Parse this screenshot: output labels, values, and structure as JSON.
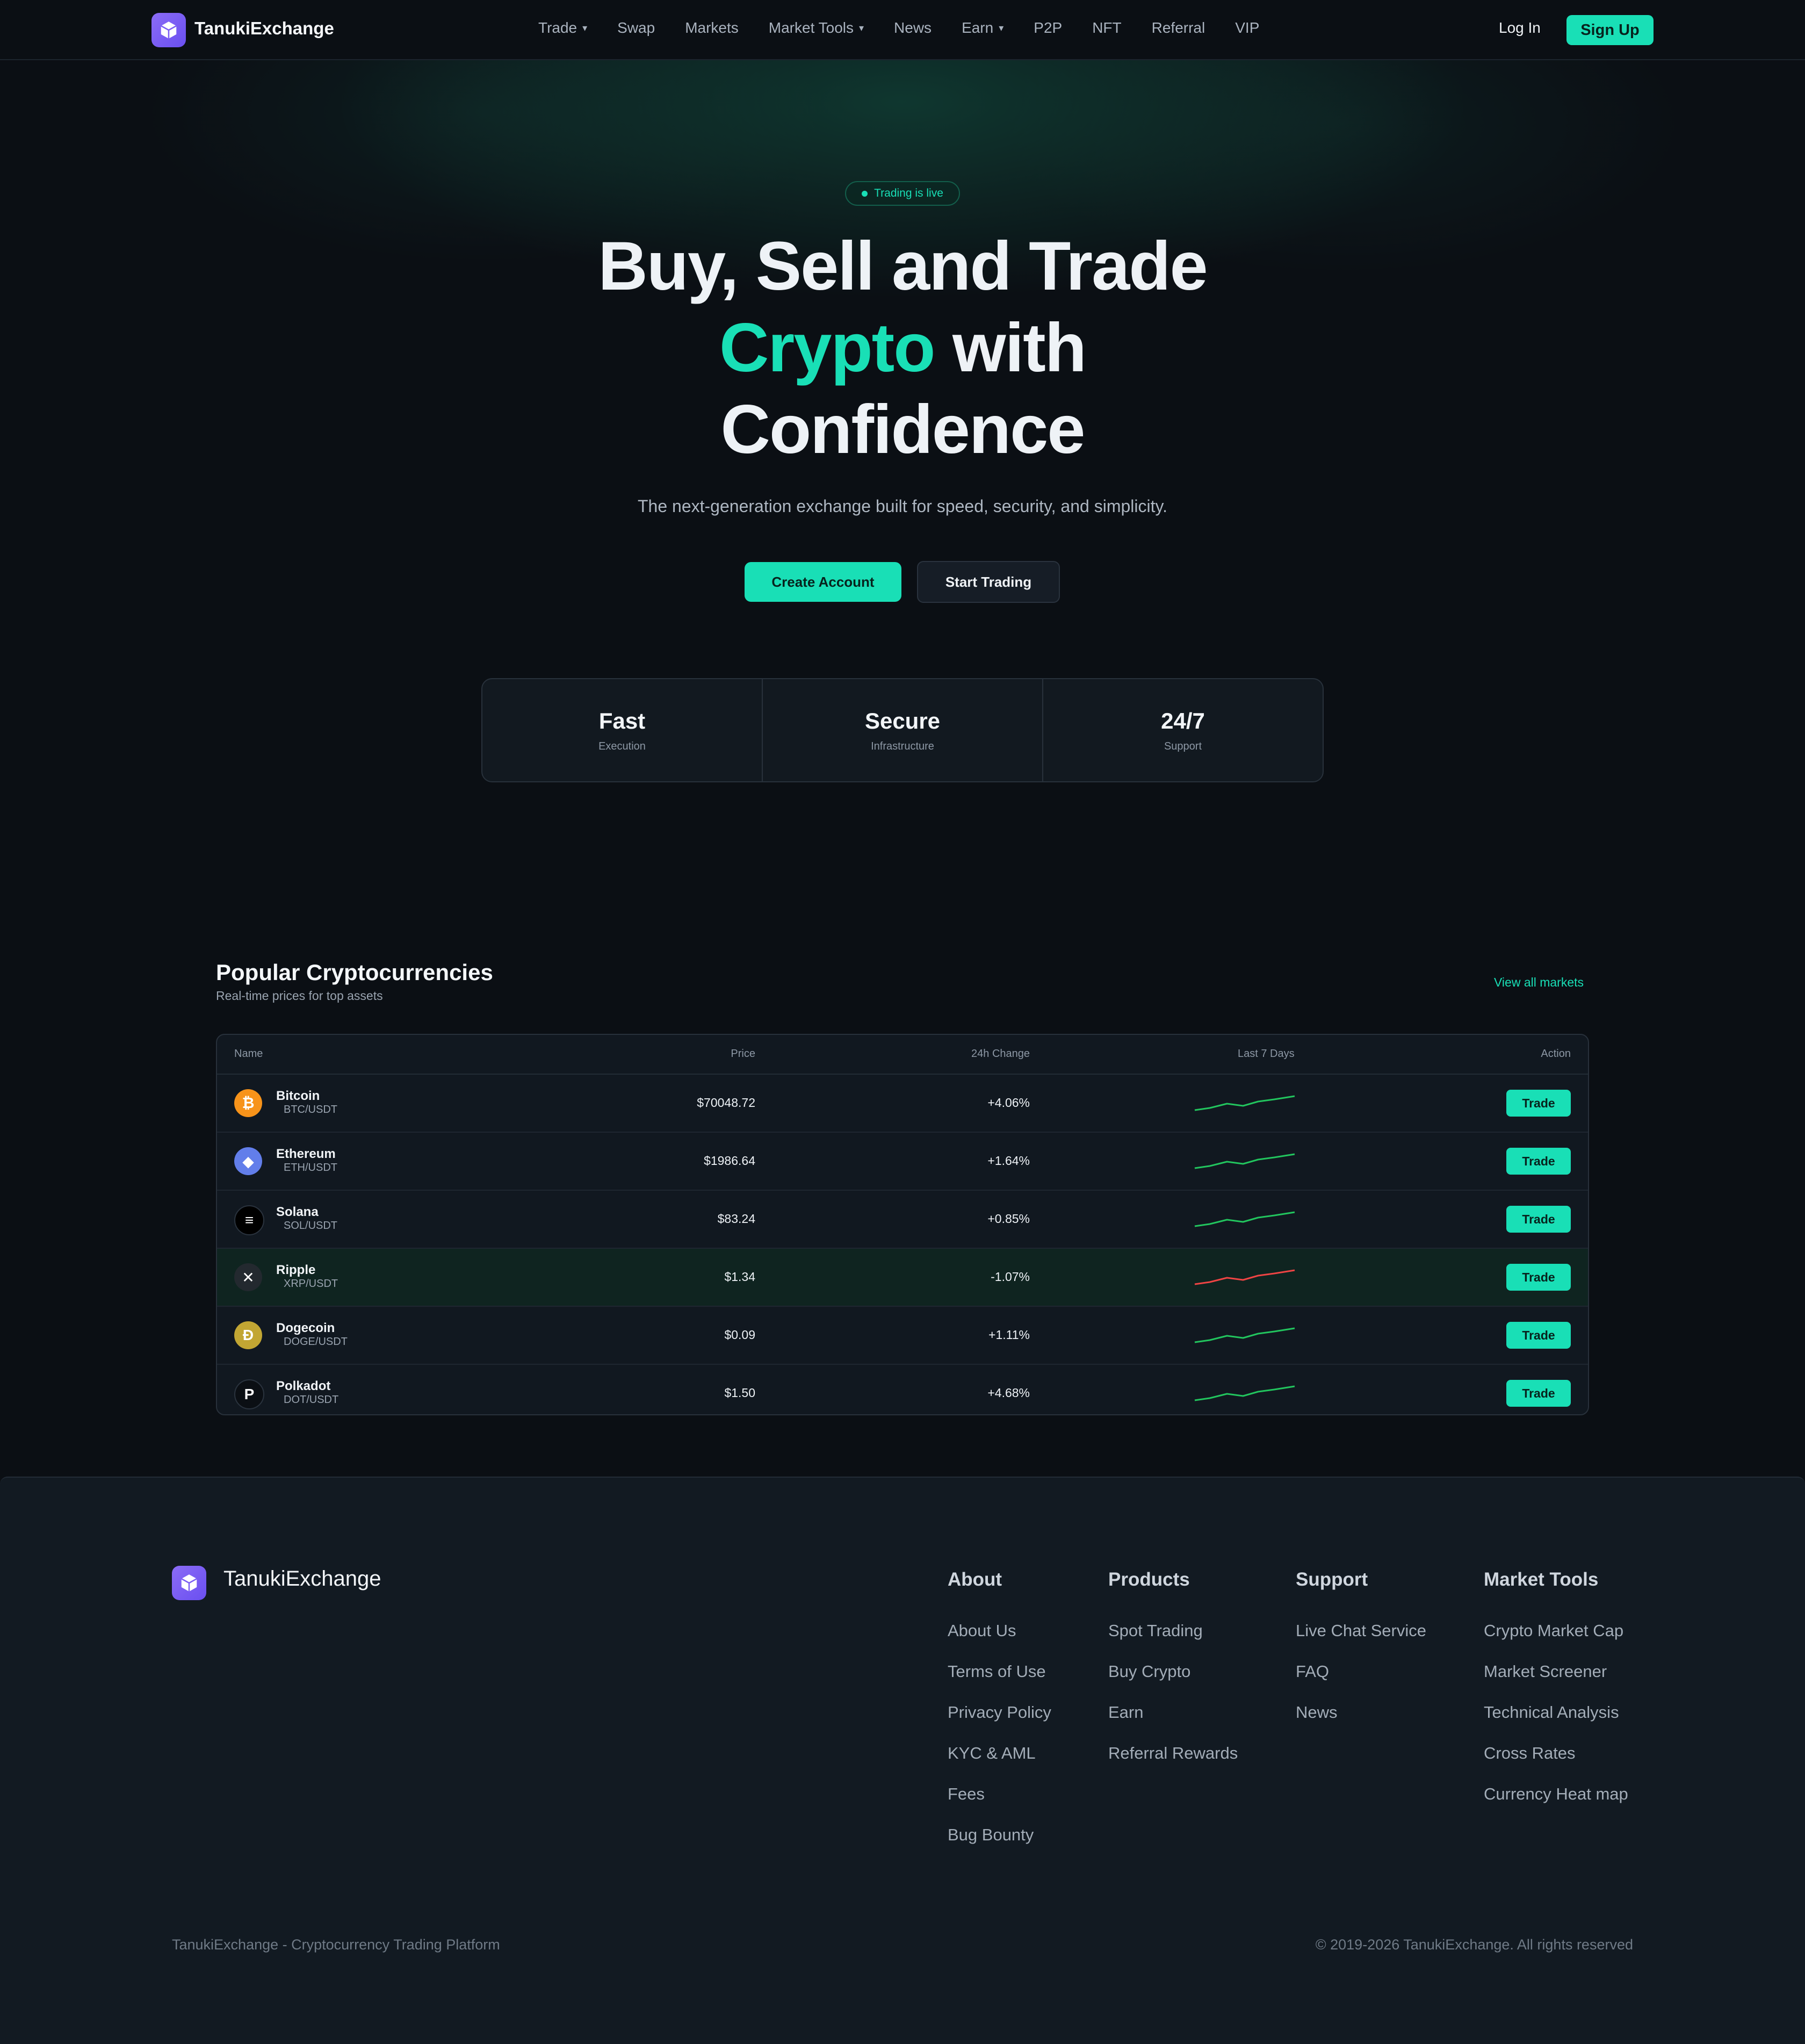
{
  "navbar": {
    "brand": "TanukiExchange",
    "links": [
      {
        "label": "Trade",
        "caret": "▾"
      },
      {
        "label": "Swap",
        "caret": ""
      },
      {
        "label": "Markets",
        "caret": ""
      },
      {
        "label": "Market Tools",
        "caret": "▾"
      },
      {
        "label": "News",
        "caret": ""
      },
      {
        "label": "Earn",
        "caret": "▾"
      },
      {
        "label": "P2P",
        "caret": ""
      },
      {
        "label": "NFT",
        "caret": ""
      },
      {
        "label": "Referral",
        "caret": ""
      },
      {
        "label": "VIP",
        "caret": ""
      }
    ],
    "login": "Log In",
    "signup": "Sign Up"
  },
  "hero": {
    "badge": "Trading is live",
    "title_line1": "Buy, Sell and Trade",
    "title_accent": "Crypto",
    "title_line2_rest": " with",
    "title_line3": "Confidence",
    "subtitle": "The next-generation exchange built for speed, security, and simplicity.",
    "cta_primary": "Create Account",
    "cta_secondary": "Start Trading",
    "stats": [
      {
        "value": "Fast",
        "label": "Execution"
      },
      {
        "value": "Secure",
        "label": "Infrastructure"
      },
      {
        "value": "24/7",
        "label": "Support"
      }
    ]
  },
  "markets": {
    "title": "Popular Cryptocurrencies",
    "subtitle": "Real-time prices for top assets",
    "view_all": "View all markets",
    "columns": {
      "name": "Name",
      "price": "Price",
      "change": "24h Change",
      "chart": "Last 7 Days",
      "action": "Action"
    },
    "rows": [
      {
        "name": "Bitcoin",
        "pair": "BTC/USDT",
        "price": "$70048.72",
        "change": "+4.06%",
        "trend": "up",
        "icon": "bitcoin-icon",
        "icon_color": "#f7931a",
        "icon_glyph": "₿",
        "trade": "Trade"
      },
      {
        "name": "Ethereum",
        "pair": "ETH/USDT",
        "price": "$1986.64",
        "change": "+1.64%",
        "trend": "up",
        "icon": "ethereum-icon",
        "icon_color": "#627eea",
        "icon_glyph": "◆",
        "trade": "Trade"
      },
      {
        "name": "Solana",
        "pair": "SOL/USDT",
        "price": "$83.24",
        "change": "+0.85%",
        "trend": "up",
        "icon": "solana-icon",
        "icon_color": "#000000",
        "icon_glyph": "≡",
        "trade": "Trade"
      },
      {
        "name": "Ripple",
        "pair": "XRP/USDT",
        "price": "$1.34",
        "change": "-1.07%",
        "trend": "down",
        "icon": "ripple-icon",
        "icon_color": "#23292f",
        "icon_glyph": "✕",
        "trade": "Trade"
      },
      {
        "name": "Dogecoin",
        "pair": "DOGE/USDT",
        "price": "$0.09",
        "change": "+1.11%",
        "trend": "up",
        "icon": "dogecoin-icon",
        "icon_color": "#c2a633",
        "icon_glyph": "Ð",
        "trade": "Trade"
      },
      {
        "name": "Polkadot",
        "pair": "DOT/USDT",
        "price": "$1.50",
        "change": "+4.68%",
        "trend": "up",
        "icon": "polkadot-icon",
        "icon_color": "#0b0f14",
        "icon_glyph": "P",
        "trade": "Trade"
      }
    ]
  },
  "footer": {
    "brand": "TanukiExchange",
    "columns": [
      {
        "title": "About",
        "links": [
          "About Us",
          "Terms of Use",
          "Privacy Policy",
          "KYC & AML",
          "Fees",
          "Bug Bounty"
        ]
      },
      {
        "title": "Products",
        "links": [
          "Spot Trading",
          "Buy Crypto",
          "Earn",
          "Referral Rewards"
        ]
      },
      {
        "title": "Support",
        "links": [
          "Live Chat Service",
          "FAQ",
          "News"
        ]
      },
      {
        "title": "Market Tools",
        "links": [
          "Crypto Market Cap",
          "Market Screener",
          "Technical Analysis",
          "Cross Rates",
          "Currency Heat map"
        ]
      }
    ],
    "tagline": "TanukiExchange - Cryptocurrency Trading Platform",
    "copyright": "© 2019-2026 TanukiExchange. All rights reserved"
  },
  "colors": {
    "accent": "#19dfb6",
    "up": "#22c55e",
    "down": "#ef4444",
    "background": "#0b0f14"
  }
}
